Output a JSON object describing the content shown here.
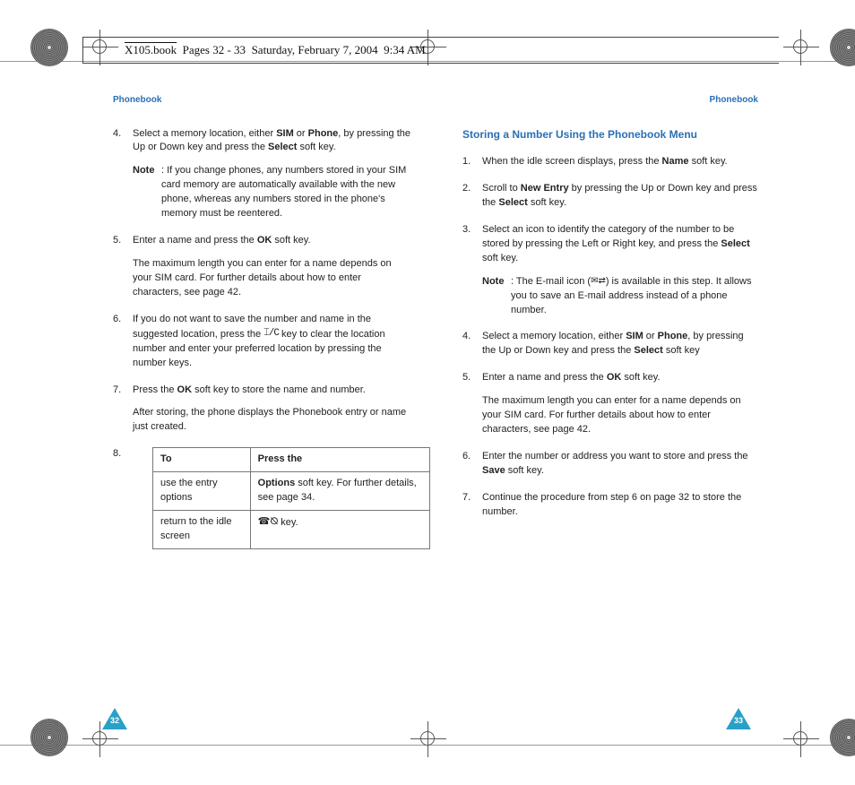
{
  "framemaker_header": {
    "filename": "X105.book",
    "pages_label": "Pages 32 - 33",
    "date": "Saturday, February 7, 2004",
    "time": "9:34 AM"
  },
  "left": {
    "running_head": "Phonebook",
    "steps": {
      "s4": {
        "num": "4.",
        "a": "Select a memory location, either ",
        "b1": "SIM",
        "c": " or ",
        "b2": "Phone",
        "d": ", by pressing the Up or Down key and press the ",
        "b3": "Select",
        "e": " soft key.",
        "note_label": "Note",
        "note_text": ": If you change phones, any numbers stored in your SIM card memory are automatically available with the new phone, whereas any numbers stored in the phone's memory must be reentered."
      },
      "s5": {
        "num": "5.",
        "a": "Enter a name and press the ",
        "b1": "OK",
        "c": " soft key.",
        "para": "The maximum length you can enter for a name depends on your SIM card. For further details about how to enter characters, see page 42."
      },
      "s6": {
        "num": "6.",
        "a": "If you do not want to save the number and name in the suggested location, press the ",
        "icon_name": "clear-key-icon",
        "icon_glyph": " ⌶/C ",
        "b": " key to clear the location number and enter your preferred location by pressing the number keys."
      },
      "s7": {
        "num": "7.",
        "a": "Press the ",
        "b1": "OK",
        "c": " soft key to store the name and number.",
        "para": "After storing, the phone displays the Phonebook entry or name just created."
      },
      "s8": {
        "num": "8."
      }
    },
    "table": {
      "h1": "To",
      "h2": "Press the",
      "r1c1": "use the entry options",
      "r1c2_b": "Options",
      "r1c2_rest": " soft key. For further details, see page 34.",
      "r2c1": "return to the idle screen",
      "r2c2_icon_name": "end-call-key-icon",
      "r2c2_icon_glyph": "☎⦰",
      "r2c2_rest": " key."
    },
    "page_number": "32"
  },
  "right": {
    "running_head": "Phonebook",
    "section_title": "Storing a Number Using the Phonebook Menu",
    "steps": {
      "s1": {
        "num": "1.",
        "a": "When the idle screen displays, press the ",
        "b1": "Name",
        "c": " soft key."
      },
      "s2": {
        "num": "2.",
        "a": "Scroll to ",
        "b1": "New Entry",
        "c": " by pressing the Up or Down key and press the ",
        "b2": "Select",
        "d": " soft key."
      },
      "s3": {
        "num": "3.",
        "a": "Select an icon to identify the category of the number to be stored by pressing the Left or Right key, and press the ",
        "b1": "Select",
        "c": " soft key.",
        "note_label": "Note",
        "note_a": ": The E-mail icon (",
        "icon_name": "email-icon",
        "icon_glyph": "✉⇄",
        "note_b": ") is available in this step. It allows you to save an E-mail address instead of a phone number."
      },
      "s4": {
        "num": "4.",
        "a": "Select a memory location, either ",
        "b1": "SIM",
        "c": " or ",
        "b2": "Phone",
        "d": ", by pressing the Up or Down key and press the ",
        "b3": "Select",
        "e": " soft key"
      },
      "s5": {
        "num": "5.",
        "a": "Enter a name and press the ",
        "b1": "OK",
        "c": " soft key.",
        "para": "The maximum length you can enter for a name depends on your SIM card. For further details about how to enter characters, see page 42."
      },
      "s6": {
        "num": "6.",
        "a": "Enter the number or address you want to store and press the ",
        "b1": "Save",
        "c": " soft key."
      },
      "s7": {
        "num": "7.",
        "a": "Continue the procedure from step 6 on page 32 to store the number."
      }
    },
    "page_number": "33"
  }
}
